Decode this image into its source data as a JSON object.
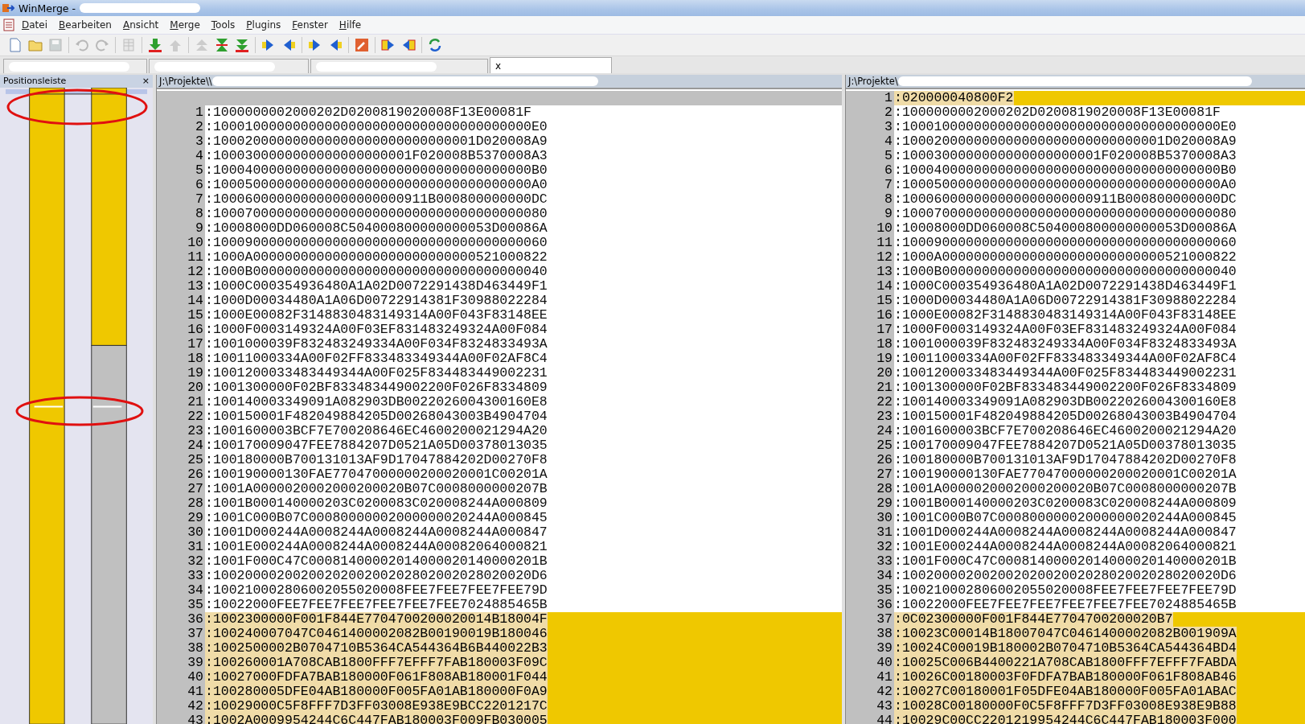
{
  "window": {
    "title": "WinMerge - "
  },
  "menu": [
    {
      "label": "Datei"
    },
    {
      "label": "Bearbeiten"
    },
    {
      "label": "Ansicht"
    },
    {
      "label": "Merge"
    },
    {
      "label": "Tools"
    },
    {
      "label": "Plugins"
    },
    {
      "label": "Fenster"
    },
    {
      "label": "Hilfe"
    }
  ],
  "toolbar": [
    {
      "kind": "new",
      "disabled": false
    },
    {
      "kind": "open",
      "disabled": false
    },
    {
      "kind": "save",
      "disabled": true
    },
    {
      "kind": "sep"
    },
    {
      "kind": "undo",
      "disabled": true
    },
    {
      "kind": "redo",
      "disabled": true
    },
    {
      "kind": "sep"
    },
    {
      "kind": "columns",
      "disabled": true
    },
    {
      "kind": "sep"
    },
    {
      "kind": "down",
      "disabled": false
    },
    {
      "kind": "up",
      "disabled": true
    },
    {
      "kind": "sep"
    },
    {
      "kind": "first",
      "disabled": true
    },
    {
      "kind": "current",
      "disabled": false
    },
    {
      "kind": "last",
      "disabled": false
    },
    {
      "kind": "sep"
    },
    {
      "kind": "right",
      "disabled": false
    },
    {
      "kind": "left",
      "disabled": false
    },
    {
      "kind": "sep"
    },
    {
      "kind": "right",
      "disabled": false
    },
    {
      "kind": "left",
      "disabled": false
    },
    {
      "kind": "sep"
    },
    {
      "kind": "wrench",
      "disabled": false
    },
    {
      "kind": "sep"
    },
    {
      "kind": "allright",
      "disabled": false
    },
    {
      "kind": "allleft",
      "disabled": false
    },
    {
      "kind": "sep"
    },
    {
      "kind": "refresh",
      "disabled": false
    }
  ],
  "tabs": [
    {
      "selected": false
    },
    {
      "selected": false
    },
    {
      "selected": false
    },
    {
      "selected": true,
      "close": "x"
    }
  ],
  "location_pane": {
    "title": "Positionsleiste",
    "close": "×"
  },
  "left": {
    "path": "J:\\Projekte\\\\",
    "lines": [
      {
        "kind": "missing"
      },
      {
        "kind": "line",
        "number": "1",
        "text": ":1000000002000202D0200819020008F13E00081F",
        "diff": false
      },
      {
        "kind": "line",
        "number": "2",
        "text": ":1000100000000000000000000000000000000000E0",
        "diff": false
      },
      {
        "kind": "line",
        "number": "3",
        "text": ":100020000000000000000000000000001D020008A9",
        "diff": false
      },
      {
        "kind": "line",
        "number": "4",
        "text": ":1000300000000000000000001F020008B5370008A3",
        "diff": false
      },
      {
        "kind": "line",
        "number": "5",
        "text": ":1000400000000000000000000000000000000000B0",
        "diff": false
      },
      {
        "kind": "line",
        "number": "6",
        "text": ":1000500000000000000000000000000000000000A0",
        "diff": false
      },
      {
        "kind": "line",
        "number": "7",
        "text": ":100060000000000000000000911B000800000000DC",
        "diff": false
      },
      {
        "kind": "line",
        "number": "8",
        "text": ":100070000000000000000000000000000000000080",
        "diff": false
      },
      {
        "kind": "line",
        "number": "9",
        "text": ":10008000DD060008C504000800000000053D00086A",
        "diff": false
      },
      {
        "kind": "line",
        "number": "10",
        "text": ":100090000000000000000000000000000000000060",
        "diff": false
      },
      {
        "kind": "line",
        "number": "11",
        "text": ":1000A0000000000000000000000000000521000822",
        "diff": false
      },
      {
        "kind": "line",
        "number": "12",
        "text": ":1000B0000000000000000000000000000000000040",
        "diff": false
      },
      {
        "kind": "line",
        "number": "13",
        "text": ":1000C000354936480A1A02D0072291438D463449F1",
        "diff": false
      },
      {
        "kind": "line",
        "number": "14",
        "text": ":1000D00034480A1A06D00722914381F30988022284",
        "diff": false
      },
      {
        "kind": "line",
        "number": "15",
        "text": ":1000E00082F3148830483149314A00F043F83148EE",
        "diff": false
      },
      {
        "kind": "line",
        "number": "16",
        "text": ":1000F0003149324A00F03EF831483249324A00F084",
        "diff": false
      },
      {
        "kind": "line",
        "number": "17",
        "text": ":1001000039F832483249334A00F034F8324833493A",
        "diff": false
      },
      {
        "kind": "line",
        "number": "18",
        "text": ":10011000334A00F02FF833483349344A00F02AF8C4",
        "diff": false
      },
      {
        "kind": "line",
        "number": "19",
        "text": ":1001200033483449344A00F025F834483449002231",
        "diff": false
      },
      {
        "kind": "line",
        "number": "20",
        "text": ":1001300000F02BF833483449002200F026F8334809",
        "diff": false
      },
      {
        "kind": "line",
        "number": "21",
        "text": ":100140003349091A082903DB0022026004300160E8",
        "diff": false
      },
      {
        "kind": "line",
        "number": "22",
        "text": ":100150001F482049884205D00268043003B4904704",
        "diff": false
      },
      {
        "kind": "line",
        "number": "23",
        "text": ":1001600003BCF7E700208646EC4600200021294A20",
        "diff": false
      },
      {
        "kind": "line",
        "number": "24",
        "text": ":100170009047FEE7884207D0521A05D00378013035",
        "diff": false
      },
      {
        "kind": "line",
        "number": "25",
        "text": ":100180000B700131013AF9D17047884202D00270F8",
        "diff": false
      },
      {
        "kind": "line",
        "number": "26",
        "text": ":100190000130FAE77047000000200020001C00201A",
        "diff": false
      },
      {
        "kind": "line",
        "number": "27",
        "text": ":1001A0000020002000200020B07C0008000000207B",
        "diff": false
      },
      {
        "kind": "line",
        "number": "28",
        "text": ":1001B000140000203C0200083C020008244A000809",
        "diff": false
      },
      {
        "kind": "line",
        "number": "29",
        "text": ":1001C000B07C00080000002000000020244A000845",
        "diff": false
      },
      {
        "kind": "line",
        "number": "30",
        "text": ":1001D000244A0008244A0008244A0008244A000847",
        "diff": false
      },
      {
        "kind": "line",
        "number": "31",
        "text": ":1001E000244A0008244A0008244A00082064000821",
        "diff": false
      },
      {
        "kind": "line",
        "number": "32",
        "text": ":1001F000C47C00081400002014000020140000201B",
        "diff": false
      },
      {
        "kind": "line",
        "number": "33",
        "text": ":1002000020020020200200202802002028020020D6",
        "diff": false
      },
      {
        "kind": "line",
        "number": "34",
        "text": ":100210002806002055020008FEE7FEE7FEE7FEE79D",
        "diff": false
      },
      {
        "kind": "line",
        "number": "35",
        "text": ":10022000FEE7FEE7FEE7FEE7FEE7FEE7024885465B",
        "diff": false
      },
      {
        "kind": "line",
        "number": "36",
        "text": ":1002300000F001F844E7704700200020014B18004F",
        "diff": true
      },
      {
        "kind": "line",
        "number": "37",
        "text": ":100240007047C0461400002082B00190019B180046",
        "diff": true
      },
      {
        "kind": "line",
        "number": "38",
        "text": ":1002500002B0704710B5364CA544364B6B440022B3",
        "diff": true
      },
      {
        "kind": "line",
        "number": "39",
        "text": ":100260001A708CAB1800FFF7EFFF7FAB180003F09C",
        "diff": true
      },
      {
        "kind": "line",
        "number": "40",
        "text": ":10027000FDFA7BAB180000F061F808AB180001F044",
        "diff": true
      },
      {
        "kind": "line",
        "number": "41",
        "text": ":100280005DFE04AB180000F005FA01AB180000F0A9",
        "diff": true
      },
      {
        "kind": "line",
        "number": "42",
        "text": ":10029000C5F8FFF7D3FF03008E938E9BCC2201217C",
        "diff": true
      },
      {
        "kind": "line",
        "number": "43",
        "text": ":1002A0009954244C6C447FAB180003F009FB030005",
        "diff": true
      }
    ]
  },
  "right": {
    "path": "J:\\Projekte\\",
    "lines": [
      {
        "kind": "line",
        "number": "1",
        "text": ":020000040800F2",
        "diff": true
      },
      {
        "kind": "line",
        "number": "2",
        "text": ":1000000002000202D0200819020008F13E00081F",
        "diff": false
      },
      {
        "kind": "line",
        "number": "3",
        "text": ":1000100000000000000000000000000000000000E0",
        "diff": false
      },
      {
        "kind": "line",
        "number": "4",
        "text": ":100020000000000000000000000000001D020008A9",
        "diff": false
      },
      {
        "kind": "line",
        "number": "5",
        "text": ":1000300000000000000000001F020008B5370008A3",
        "diff": false
      },
      {
        "kind": "line",
        "number": "6",
        "text": ":1000400000000000000000000000000000000000B0",
        "diff": false
      },
      {
        "kind": "line",
        "number": "7",
        "text": ":1000500000000000000000000000000000000000A0",
        "diff": false
      },
      {
        "kind": "line",
        "number": "8",
        "text": ":100060000000000000000000911B000800000000DC",
        "diff": false
      },
      {
        "kind": "line",
        "number": "9",
        "text": ":100070000000000000000000000000000000000080",
        "diff": false
      },
      {
        "kind": "line",
        "number": "10",
        "text": ":10008000DD060008C504000800000000053D00086A",
        "diff": false
      },
      {
        "kind": "line",
        "number": "11",
        "text": ":100090000000000000000000000000000000000060",
        "diff": false
      },
      {
        "kind": "line",
        "number": "12",
        "text": ":1000A0000000000000000000000000000521000822",
        "diff": false
      },
      {
        "kind": "line",
        "number": "13",
        "text": ":1000B0000000000000000000000000000000000040",
        "diff": false
      },
      {
        "kind": "line",
        "number": "14",
        "text": ":1000C000354936480A1A02D0072291438D463449F1",
        "diff": false
      },
      {
        "kind": "line",
        "number": "15",
        "text": ":1000D00034480A1A06D00722914381F30988022284",
        "diff": false
      },
      {
        "kind": "line",
        "number": "16",
        "text": ":1000E00082F3148830483149314A00F043F83148EE",
        "diff": false
      },
      {
        "kind": "line",
        "number": "17",
        "text": ":1000F0003149324A00F03EF831483249324A00F084",
        "diff": false
      },
      {
        "kind": "line",
        "number": "18",
        "text": ":1001000039F832483249334A00F034F8324833493A",
        "diff": false
      },
      {
        "kind": "line",
        "number": "19",
        "text": ":10011000334A00F02FF833483349344A00F02AF8C4",
        "diff": false
      },
      {
        "kind": "line",
        "number": "20",
        "text": ":1001200033483449344A00F025F834483449002231",
        "diff": false
      },
      {
        "kind": "line",
        "number": "21",
        "text": ":1001300000F02BF833483449002200F026F8334809",
        "diff": false
      },
      {
        "kind": "line",
        "number": "22",
        "text": ":100140003349091A082903DB0022026004300160E8",
        "diff": false
      },
      {
        "kind": "line",
        "number": "23",
        "text": ":100150001F482049884205D00268043003B4904704",
        "diff": false
      },
      {
        "kind": "line",
        "number": "24",
        "text": ":1001600003BCF7E700208646EC4600200021294A20",
        "diff": false
      },
      {
        "kind": "line",
        "number": "25",
        "text": ":100170009047FEE7884207D0521A05D00378013035",
        "diff": false
      },
      {
        "kind": "line",
        "number": "26",
        "text": ":100180000B700131013AF9D17047884202D00270F8",
        "diff": false
      },
      {
        "kind": "line",
        "number": "27",
        "text": ":100190000130FAE77047000000200020001C00201A",
        "diff": false
      },
      {
        "kind": "line",
        "number": "28",
        "text": ":1001A0000020002000200020B07C0008000000207B",
        "diff": false
      },
      {
        "kind": "line",
        "number": "29",
        "text": ":1001B000140000203C0200083C020008244A000809",
        "diff": false
      },
      {
        "kind": "line",
        "number": "30",
        "text": ":1001C000B07C00080000002000000020244A000845",
        "diff": false
      },
      {
        "kind": "line",
        "number": "31",
        "text": ":1001D000244A0008244A0008244A0008244A000847",
        "diff": false
      },
      {
        "kind": "line",
        "number": "32",
        "text": ":1001E000244A0008244A0008244A00082064000821",
        "diff": false
      },
      {
        "kind": "line",
        "number": "33",
        "text": ":1001F000C47C00081400002014000020140000201B",
        "diff": false
      },
      {
        "kind": "line",
        "number": "34",
        "text": ":1002000020020020200200202802002028020020D6",
        "diff": false
      },
      {
        "kind": "line",
        "number": "35",
        "text": ":100210002806002055020008FEE7FEE7FEE7FEE79D",
        "diff": false
      },
      {
        "kind": "line",
        "number": "36",
        "text": ":10022000FEE7FEE7FEE7FEE7FEE7FEE7024885465B",
        "diff": false
      },
      {
        "kind": "line",
        "number": "37",
        "text": ":0C02300000F001F844E7704700200020B7",
        "diff": true
      },
      {
        "kind": "line",
        "number": "38",
        "text": ":10023C00014B18007047C0461400002082B001909A",
        "diff": true
      },
      {
        "kind": "line",
        "number": "39",
        "text": ":10024C00019B180002B0704710B5364CA544364BD4",
        "diff": true
      },
      {
        "kind": "line",
        "number": "40",
        "text": ":10025C006B4400221A708CAB1800FFF7EFFF7FABDA",
        "diff": true
      },
      {
        "kind": "line",
        "number": "41",
        "text": ":10026C00180003F0FDFA7BAB180000F061F808AB46",
        "diff": true
      },
      {
        "kind": "line",
        "number": "42",
        "text": ":10027C00180001F05DFE04AB180000F005FA01ABAC",
        "diff": true
      },
      {
        "kind": "line",
        "number": "43",
        "text": ":10028C00180000F0C5F8FFF7D3FF03008E938E9B88",
        "diff": true
      },
      {
        "kind": "line",
        "number": "44",
        "text": ":10029C00CC2201219954244C6C447FAB180003F000",
        "diff": true
      }
    ]
  }
}
